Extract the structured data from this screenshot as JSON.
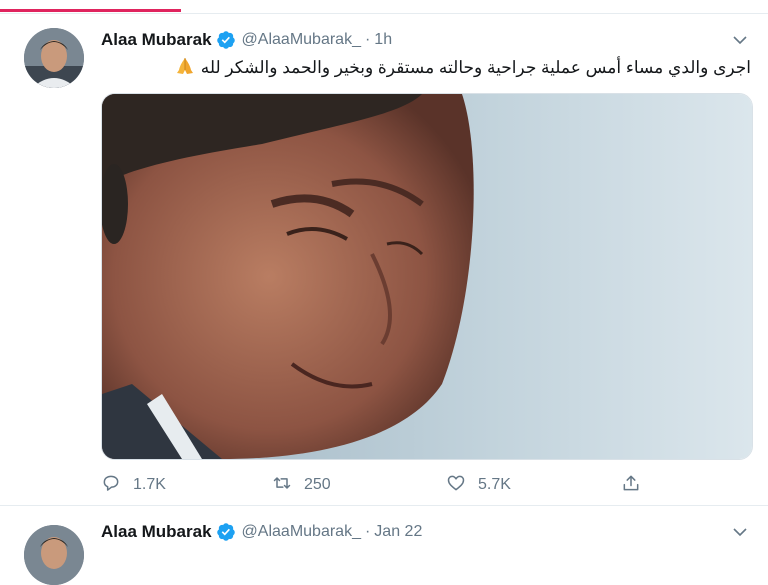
{
  "colors": {
    "accent": "#1da1f2",
    "tab_indicator": "#e0245e",
    "secondary_text": "#657786",
    "divider": "#e6ecf0"
  },
  "tweets": [
    {
      "name": "Alaa Mubarak",
      "handle": "@AlaaMubarak_",
      "separator": "·",
      "time": "1h",
      "text": "اجرى والدي مساء أمس عملية جراحية وحالته مستقرة وبخير والحمد والشكر لله",
      "emoji": "folded-hands",
      "actions": {
        "reply_count": "1.7K",
        "retweet_count": "250",
        "like_count": "5.7K"
      },
      "icons": [
        "verified-icon",
        "chevron-down-icon",
        "reply-icon",
        "retweet-icon",
        "like-icon",
        "share-icon"
      ]
    },
    {
      "name": "Alaa Mubarak",
      "handle": "@AlaaMubarak_",
      "separator": "·",
      "time": "Jan 22",
      "icons": [
        "verified-icon",
        "chevron-down-icon"
      ]
    }
  ]
}
